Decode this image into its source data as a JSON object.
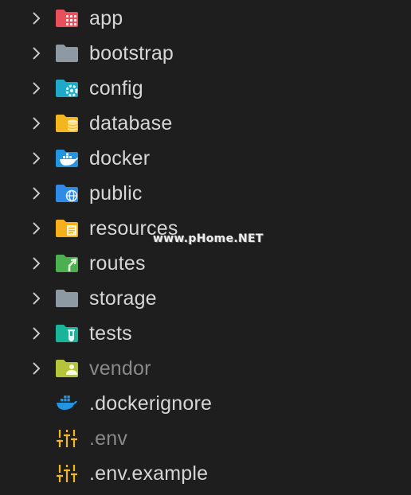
{
  "explorer": {
    "items": [
      {
        "label": "app",
        "icon": "app-folder-icon",
        "color": "#e8505b",
        "type": "folder",
        "muted": false
      },
      {
        "label": "bootstrap",
        "icon": "folder-icon",
        "color": "#8e9aa3",
        "type": "folder",
        "muted": false
      },
      {
        "label": "config",
        "icon": "config-folder-icon",
        "color": "#1fa9c8",
        "type": "folder",
        "muted": false
      },
      {
        "label": "database",
        "icon": "database-folder-icon",
        "color": "#f3b61f",
        "type": "folder",
        "muted": false
      },
      {
        "label": "docker",
        "icon": "docker-folder-icon",
        "color": "#2394e0",
        "type": "folder",
        "muted": false
      },
      {
        "label": "public",
        "icon": "public-folder-icon",
        "color": "#2f8be6",
        "type": "folder",
        "muted": false
      },
      {
        "label": "resources",
        "icon": "resources-folder-icon",
        "color": "#f6b01e",
        "type": "folder",
        "muted": false
      },
      {
        "label": "routes",
        "icon": "routes-folder-icon",
        "color": "#4caf50",
        "type": "folder",
        "muted": false
      },
      {
        "label": "storage",
        "icon": "folder-icon",
        "color": "#8e9aa3",
        "type": "folder",
        "muted": false
      },
      {
        "label": "tests",
        "icon": "tests-folder-icon",
        "color": "#18b59b",
        "type": "folder",
        "muted": false
      },
      {
        "label": "vendor",
        "icon": "vendor-folder-icon",
        "color": "#b5c43a",
        "type": "folder",
        "muted": true
      },
      {
        "label": ".dockerignore",
        "icon": "docker-icon",
        "color": "#2394e0",
        "type": "file",
        "muted": false
      },
      {
        "label": ".env",
        "icon": "env-settings-icon",
        "color": "#f3b61f",
        "type": "file",
        "muted": true
      },
      {
        "label": ".env.example",
        "icon": "env-settings-icon",
        "color": "#f3b61f",
        "type": "file",
        "muted": false
      }
    ]
  },
  "watermark": {
    "text": "www.pHome.NET"
  }
}
